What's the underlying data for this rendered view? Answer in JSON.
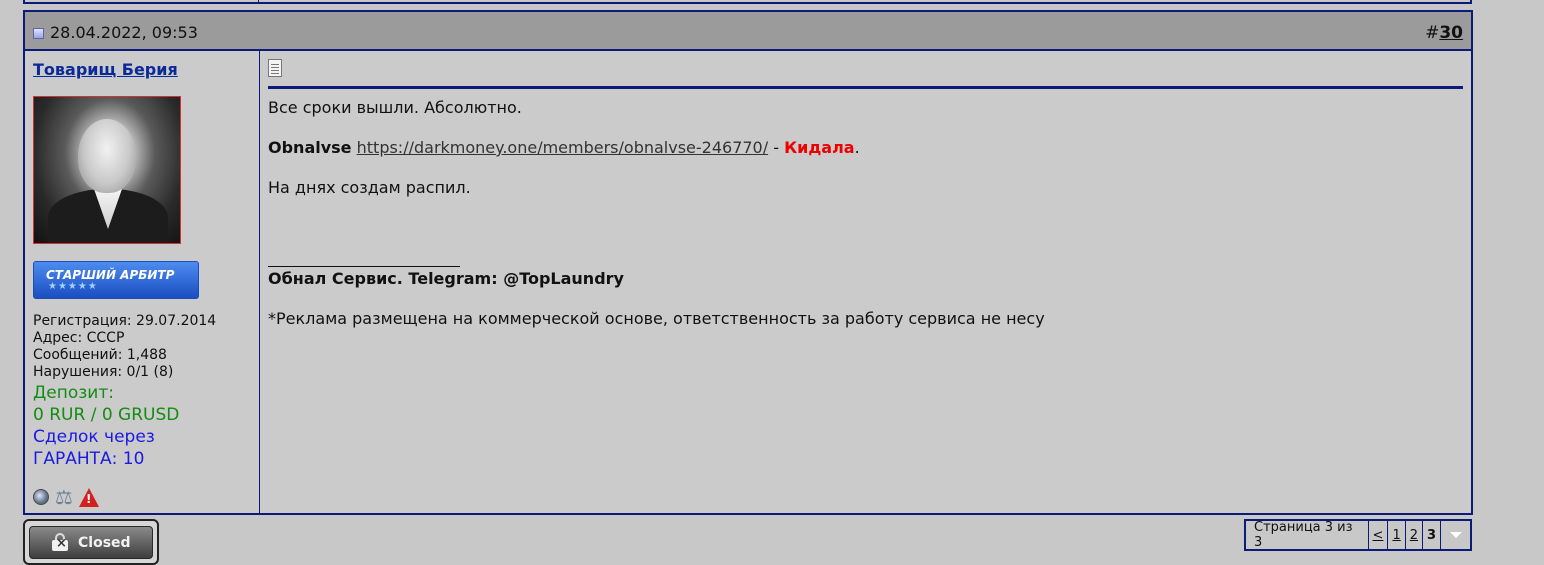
{
  "post": {
    "date": "28.04.2022, 09:53",
    "number_prefix": "#",
    "number": "30"
  },
  "user": {
    "name": "Товарищ Берия",
    "rank": "СТАРШИЙ АРБИТР",
    "rank_stars": "★★★★★",
    "registration": "Регистрация: 29.07.2014",
    "address": "Адрес: СССР",
    "messages": "Сообщений: 1,488",
    "violations": "Нарушения: 0/1 (8)",
    "deposit_label": "Депозит:",
    "deposit_value": "0 RUR / 0 GRUSD",
    "deals_label": "Сделок через",
    "deals_value": "ГАРАНТА: 10",
    "icons": [
      "status-offline-icon",
      "scales-icon",
      "warning-icon"
    ]
  },
  "message": {
    "line1": "Все сроки вышли. Абсолютно.",
    "bold_name": "Obnalvse",
    "link": "https://darkmoney.one/members/obnalvse-246770/",
    "dash": " - ",
    "scam": "Кидала",
    "period": ".",
    "line3": "На днях создам распил."
  },
  "signature": {
    "title": "Обнал Сервис. Telegram: @TopLaundry",
    "note": "*Реклама размещена на коммерческой основе, ответственность за работу сервиса не несу"
  },
  "closed_button": {
    "label": "Closed"
  },
  "pager": {
    "info": "Страница 3 из 3",
    "prev": "<",
    "pages": [
      "1",
      "2"
    ],
    "current": "3"
  },
  "colors": {
    "border": "#0c1a78",
    "header_bg": "#9b9b9b",
    "page_bg": "#c8c8c8",
    "deposit": "#148c14",
    "deals": "#1a1ae0",
    "scam": "#e00000",
    "username": "#0a2a9a"
  }
}
